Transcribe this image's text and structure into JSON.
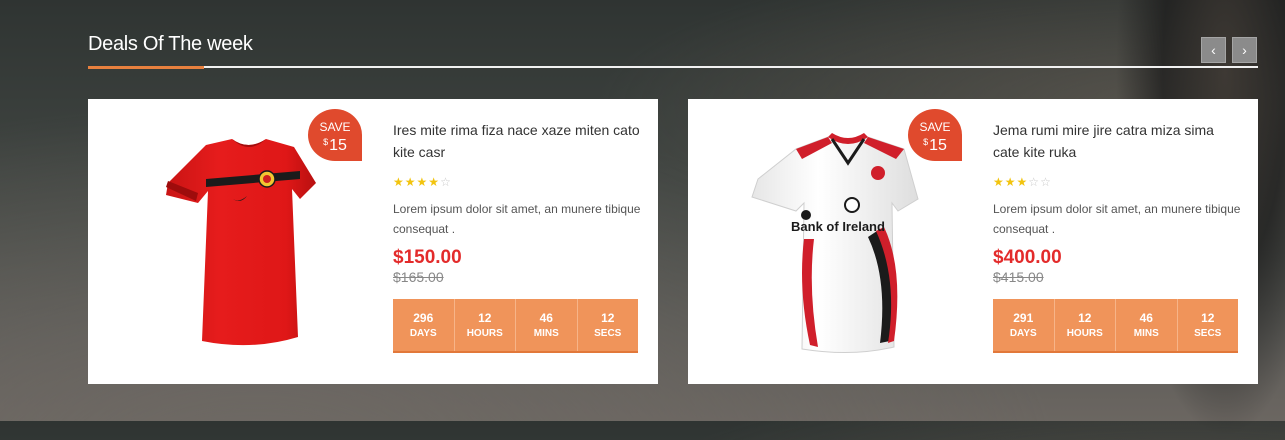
{
  "section": {
    "title": "Deals Of The week",
    "prev_icon": "chevron-left-icon",
    "prev_glyph": "‹",
    "next_icon": "chevron-right-icon",
    "next_glyph": "›"
  },
  "colors": {
    "accent": "#e8803e",
    "badge": "#e04a2d",
    "price": "#e32b2b",
    "countdown": "#f0945a",
    "star": "#f2c40f"
  },
  "deals": [
    {
      "save_label": "SAVE",
      "save_currency": "$",
      "save_amount": "15",
      "image": "red-tshirt-image",
      "name": "Ires mite rima fiza nace xaze miten cato kite casr",
      "rating": 4,
      "rating_max": 5,
      "description": "Lorem ipsum dolor sit amet, an munere tibique consequat .",
      "price": "$150.00",
      "old_price": "$165.00",
      "countdown": [
        {
          "value": "296",
          "unit": "DAYS"
        },
        {
          "value": "12",
          "unit": "HOURS"
        },
        {
          "value": "46",
          "unit": "MINS"
        },
        {
          "value": "12",
          "unit": "SECS"
        }
      ]
    },
    {
      "save_label": "SAVE",
      "save_currency": "$",
      "save_amount": "15",
      "image": "white-rugby-jersey-image",
      "jersey_text": "Bank of Ireland",
      "name": "Jema rumi mire jire catra miza sima cate kite ruka",
      "rating": 3,
      "rating_max": 5,
      "description": "Lorem ipsum dolor sit amet, an munere tibique consequat .",
      "price": "$400.00",
      "old_price": "$415.00",
      "countdown": [
        {
          "value": "291",
          "unit": "DAYS"
        },
        {
          "value": "12",
          "unit": "HOURS"
        },
        {
          "value": "46",
          "unit": "MINS"
        },
        {
          "value": "12",
          "unit": "SECS"
        }
      ]
    }
  ]
}
